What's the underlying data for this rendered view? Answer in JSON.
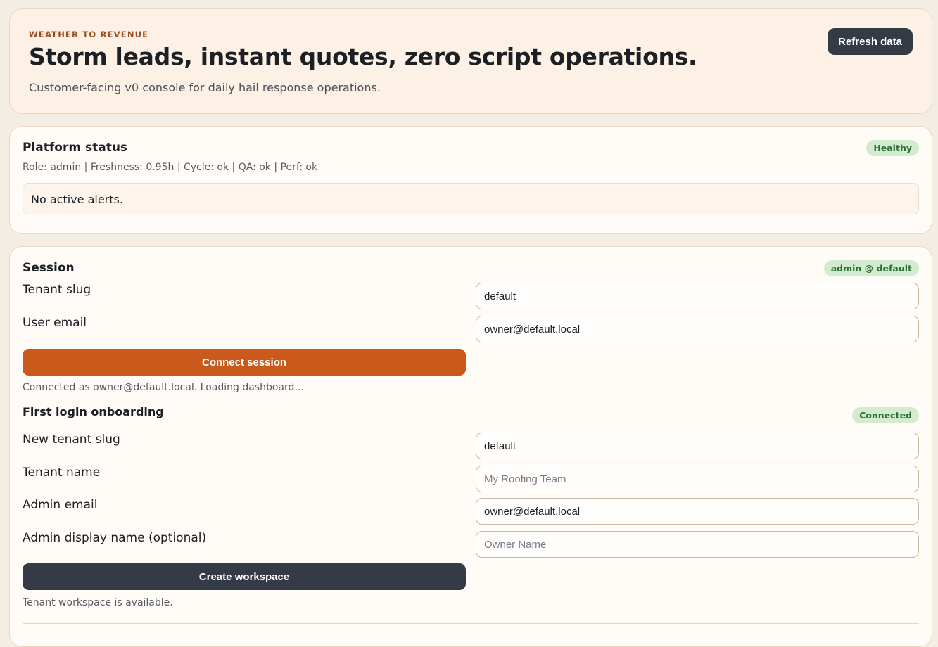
{
  "header": {
    "eyebrow": "WEATHER TO REVENUE",
    "title": "Storm leads, instant quotes, zero script operations.",
    "subtitle": "Customer-facing v0 console for daily hail response operations.",
    "refresh_label": "Refresh data"
  },
  "platform_status": {
    "title": "Platform status",
    "badge": "Healthy",
    "meta": "Role: admin | Freshness: 0.95h | Cycle: ok | QA: ok | Perf: ok",
    "alerts_text": "No active alerts."
  },
  "session": {
    "title": "Session",
    "badge": "admin @ default",
    "tenant_slug_label": "Tenant slug",
    "tenant_slug_value": "default",
    "user_email_label": "User email",
    "user_email_value": "owner@default.local",
    "connect_label": "Connect session",
    "status_text": "Connected as owner@default.local. Loading dashboard..."
  },
  "onboarding": {
    "title": "First login onboarding",
    "badge": "Connected",
    "new_tenant_slug_label": "New tenant slug",
    "new_tenant_slug_value": "default",
    "tenant_name_label": "Tenant name",
    "tenant_name_placeholder": "My Roofing Team",
    "admin_email_label": "Admin email",
    "admin_email_value": "owner@default.local",
    "admin_display_name_label": "Admin display name (optional)",
    "admin_display_name_placeholder": "Owner Name",
    "create_label": "Create workspace",
    "status_text": "Tenant workspace is available."
  },
  "colors": {
    "accent": "#c95a1b",
    "dark_button": "#343a46",
    "badge_bg": "#d3eccf",
    "badge_text": "#2c6f3a",
    "eyebrow": "#9a4a1a"
  }
}
